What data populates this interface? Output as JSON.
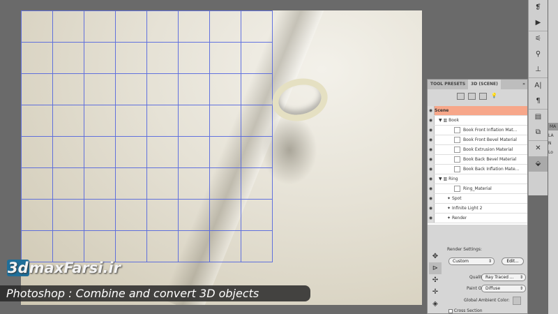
{
  "panel": {
    "tabs": [
      "TOOL PRESETS",
      "3D (SCENE)"
    ],
    "menu": "»",
    "items": [
      {
        "label": "Scene",
        "type": "scene"
      },
      {
        "label": "Book",
        "type": "sub"
      },
      {
        "label": "Book Front Inflation Mat...",
        "type": "mat"
      },
      {
        "label": "Book Front Bevel Material",
        "type": "mat"
      },
      {
        "label": "Book Extrusion Material",
        "type": "mat"
      },
      {
        "label": "Book Back Bevel Material",
        "type": "mat"
      },
      {
        "label": "Book Back Inflation Mate...",
        "type": "mat"
      },
      {
        "label": "Ring",
        "type": "sub"
      },
      {
        "label": "Ring_Material",
        "type": "mat"
      },
      {
        "label": "Spot",
        "type": "lvl"
      },
      {
        "label": "Infinite Light 2",
        "type": "lvl"
      },
      {
        "label": "Render",
        "type": "lvl"
      }
    ],
    "render_settings_label": "Render Settings:",
    "preset": "Custom",
    "edit_button": "Edit...",
    "quality_label": "Quality:",
    "quality": "Ray Traced ...",
    "paint_on_label": "Paint On:",
    "paint_on": "Diffuse",
    "ambient_label": "Global Ambient Color:",
    "cross_section": "Cross Section"
  },
  "side2": {
    "tab": "MA",
    "l1": "LA",
    "l2": "N",
    "l3": "Lo"
  },
  "watermark": {
    "prefix": "3d",
    "rest": "maxFarsi.ir"
  },
  "caption": "Photoshop : Combine and convert 3D objects"
}
